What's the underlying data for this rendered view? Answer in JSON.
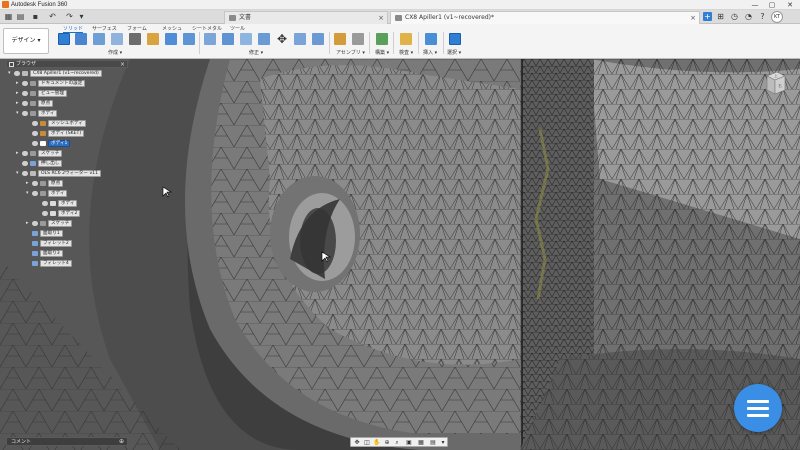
{
  "window": {
    "title": "Autodesk Fusion 360",
    "controls": [
      "—",
      "▢",
      "✕"
    ]
  },
  "tabs": [
    {
      "label": "文書",
      "active": false
    },
    {
      "label": "CX8 Apiller1 (v1~recovered)*",
      "active": true
    }
  ],
  "user": {
    "initials": "KT"
  },
  "ribbon": {
    "workspace": "デザイン ▾",
    "tabs": [
      "ソリッド",
      "サーフェス",
      "フォーム",
      "メッシュ",
      "シートメタル",
      "ツール"
    ],
    "active_tab": "ソリッド",
    "groups": [
      "作成 ▾",
      "修正 ▾",
      "アセンブリ ▾",
      "構築 ▾",
      "検査 ▾",
      "挿入 ▾",
      "選択 ▾"
    ]
  },
  "browser": {
    "header": "ブラウザ",
    "nodes": [
      {
        "label": "CX8 Apiller1 (v1~recovered)",
        "expanded": true
      },
      {
        "label": "ドキュメントの設定",
        "expanded": false
      },
      {
        "label": "ビュー管理",
        "expanded": false
      },
      {
        "label": "原点",
        "expanded": false
      },
      {
        "label": "ボディ",
        "expanded": true
      },
      {
        "label": "メッシュボディ",
        "expanded": false
      },
      {
        "label": "ボディ (SKET)",
        "expanded": false
      },
      {
        "label": "ボディ1",
        "expanded": false,
        "selected": true
      },
      {
        "label": "スケッチ",
        "expanded": false
      },
      {
        "label": "押し出し",
        "expanded": false
      },
      {
        "label": "OLS RC6 2ウィーター v11",
        "expanded": true
      },
      {
        "label": "原点",
        "expanded": false
      },
      {
        "label": "ボディ",
        "expanded": true
      },
      {
        "label": "ボディ",
        "expanded": false
      },
      {
        "label": "ボディ2",
        "expanded": false
      },
      {
        "label": "スケッチ",
        "expanded": false
      },
      {
        "label": "面取り1",
        "expanded": false
      },
      {
        "label": "フィレット2",
        "expanded": false
      },
      {
        "label": "面取り3",
        "expanded": false
      },
      {
        "label": "フィレット4",
        "expanded": false
      }
    ]
  },
  "viewcube": {
    "face_label": "上",
    "corner_label": "右"
  },
  "comments": {
    "label": "コメント"
  },
  "colors": {
    "accent": "#2f7fd4",
    "fab": "#3a8ee6",
    "model_edge": "#1c1c1c",
    "model_face": "#8c8c8c"
  }
}
